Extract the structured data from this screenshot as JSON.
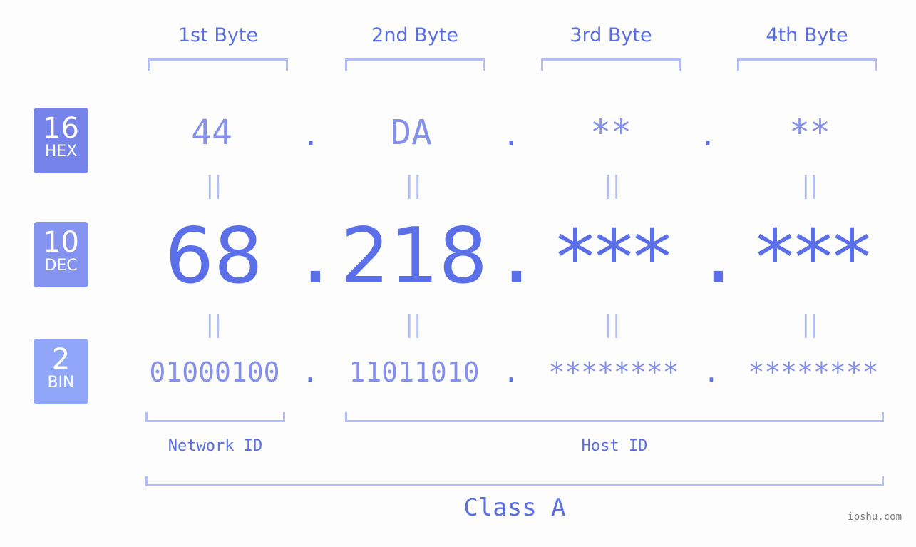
{
  "headers": [
    "1st Byte",
    "2nd Byte",
    "3rd Byte",
    "4th Byte"
  ],
  "badges": [
    {
      "base": "16",
      "label": "HEX",
      "color": "#7583ea"
    },
    {
      "base": "10",
      "label": "DEC",
      "color": "#8593f0"
    },
    {
      "base": "2",
      "label": "BIN",
      "color": "#90a6f8"
    }
  ],
  "hex": [
    "44",
    "DA",
    "**",
    "**"
  ],
  "dec": [
    "68",
    "218",
    "***",
    "***"
  ],
  "bin": [
    "01000100",
    "11011010",
    "********",
    "********"
  ],
  "separator": ".",
  "equals": "||",
  "network_label": "Network ID",
  "host_label": "Host ID",
  "class_label": "Class A",
  "watermark": "ipshu.com"
}
